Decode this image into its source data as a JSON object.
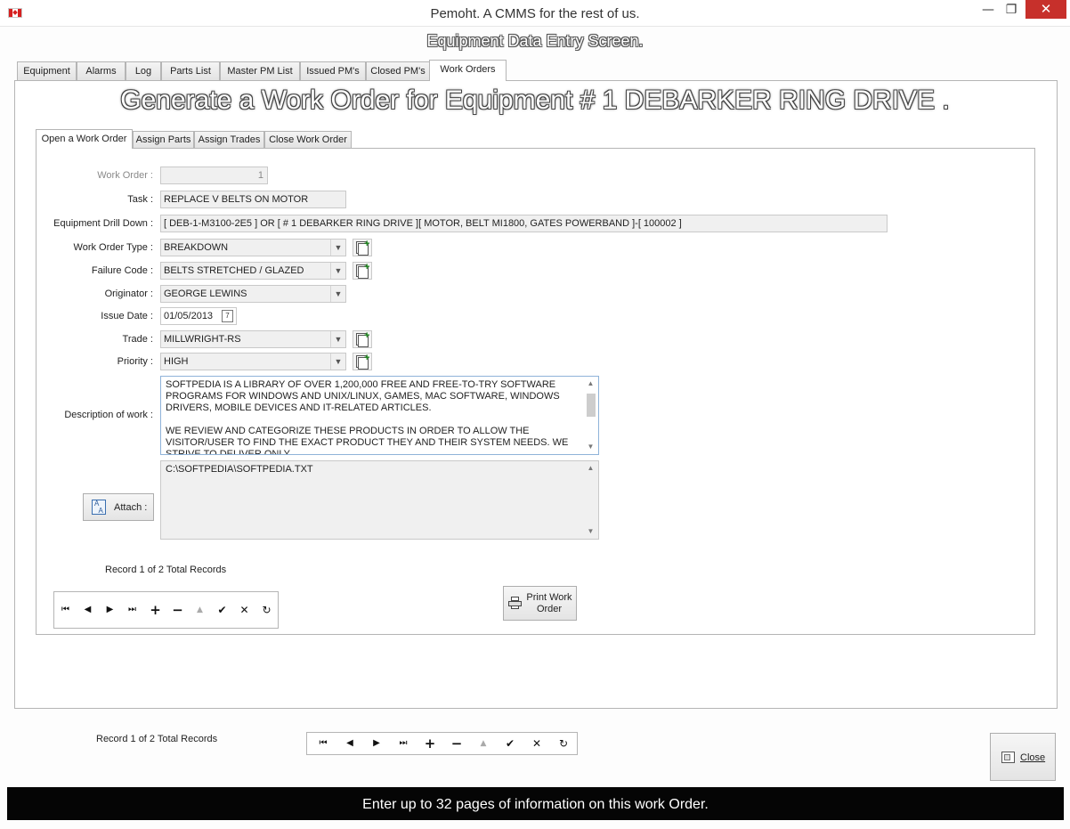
{
  "window": {
    "title": "Pemoht.  A CMMS for the rest of us.",
    "minimize": "—",
    "maximize": "❐",
    "close": "✕"
  },
  "screen_title": "Equipment Data Entry Screen.",
  "outer_tabs": [
    "Equipment",
    "Alarms",
    "Log",
    "Parts List",
    "Master PM List",
    "Issued PM's",
    "Closed PM's",
    "Work Orders"
  ],
  "active_outer_tab": "Work Orders",
  "heading": "Generate a Work Order for Equipment # 1 DEBARKER RING DRIVE .",
  "inner_tabs": [
    "Open a Work Order",
    "Assign Parts",
    "Assign Trades",
    "Close Work Order"
  ],
  "active_inner_tab": "Open a Work Order",
  "form": {
    "work_order_label": "Work Order :",
    "work_order_value": "1",
    "task_label": "Task :",
    "task_value": "REPLACE V BELTS ON MOTOR",
    "drill_label": "Equipment Drill Down :",
    "drill_value": "[ DEB-1-M3100-2E5 ] OR [ # 1 DEBARKER RING DRIVE ][ MOTOR, BELT MI1800, GATES POWERBAND ]-[ 100002 ]",
    "type_label": "Work Order Type :",
    "type_value": "BREAKDOWN",
    "failure_label": "Failure Code :",
    "failure_value": "BELTS STRETCHED / GLAZED",
    "originator_label": "Originator :",
    "originator_value": "GEORGE LEWINS",
    "issue_label": "Issue Date :",
    "issue_value": "01/05/2013",
    "calendar_day": "7",
    "trade_label": "Trade :",
    "trade_value": "MILLWRIGHT-RS",
    "priority_label": "Priority :",
    "priority_value": "HIGH",
    "description_label": "Description of work :",
    "description_p1": "SOFTPEDIA IS A LIBRARY OF OVER 1,200,000 FREE AND FREE-TO-TRY SOFTWARE PROGRAMS FOR WINDOWS AND UNIX/LINUX, GAMES, MAC SOFTWARE, WINDOWS DRIVERS, MOBILE DEVICES AND IT-RELATED ARTICLES.",
    "description_p2": "WE REVIEW AND CATEGORIZE THESE PRODUCTS IN ORDER TO ALLOW THE VISITOR/USER TO FIND THE EXACT PRODUCT THEY AND THEIR SYSTEM NEEDS. WE STRIVE TO DELIVER ONLY",
    "attach_label": "Attach :",
    "attach_value": "C:\\SOFTPEDIA\\SOFTPEDIA.TXT",
    "record_text": "Record 1 of 2 Total Records",
    "print_label_1": "Print Work",
    "print_label_2": "Order"
  },
  "nav_icons": {
    "first": "⏮",
    "prev": "◀",
    "next": "▶",
    "last": "⏭",
    "add": "+",
    "remove": "−",
    "up": "▲",
    "post": "✔",
    "cancel": "✕",
    "refresh": "↻"
  },
  "bottom": {
    "record_text": "Record 1 of 2 Total Records",
    "close_label": "Close"
  },
  "status_text": "Enter up to 32 pages of information on this work Order.",
  "colors": {
    "status_bg": "#050505",
    "close_button_red": "#c7302b",
    "add_icon_green": "#1c8a1c"
  }
}
